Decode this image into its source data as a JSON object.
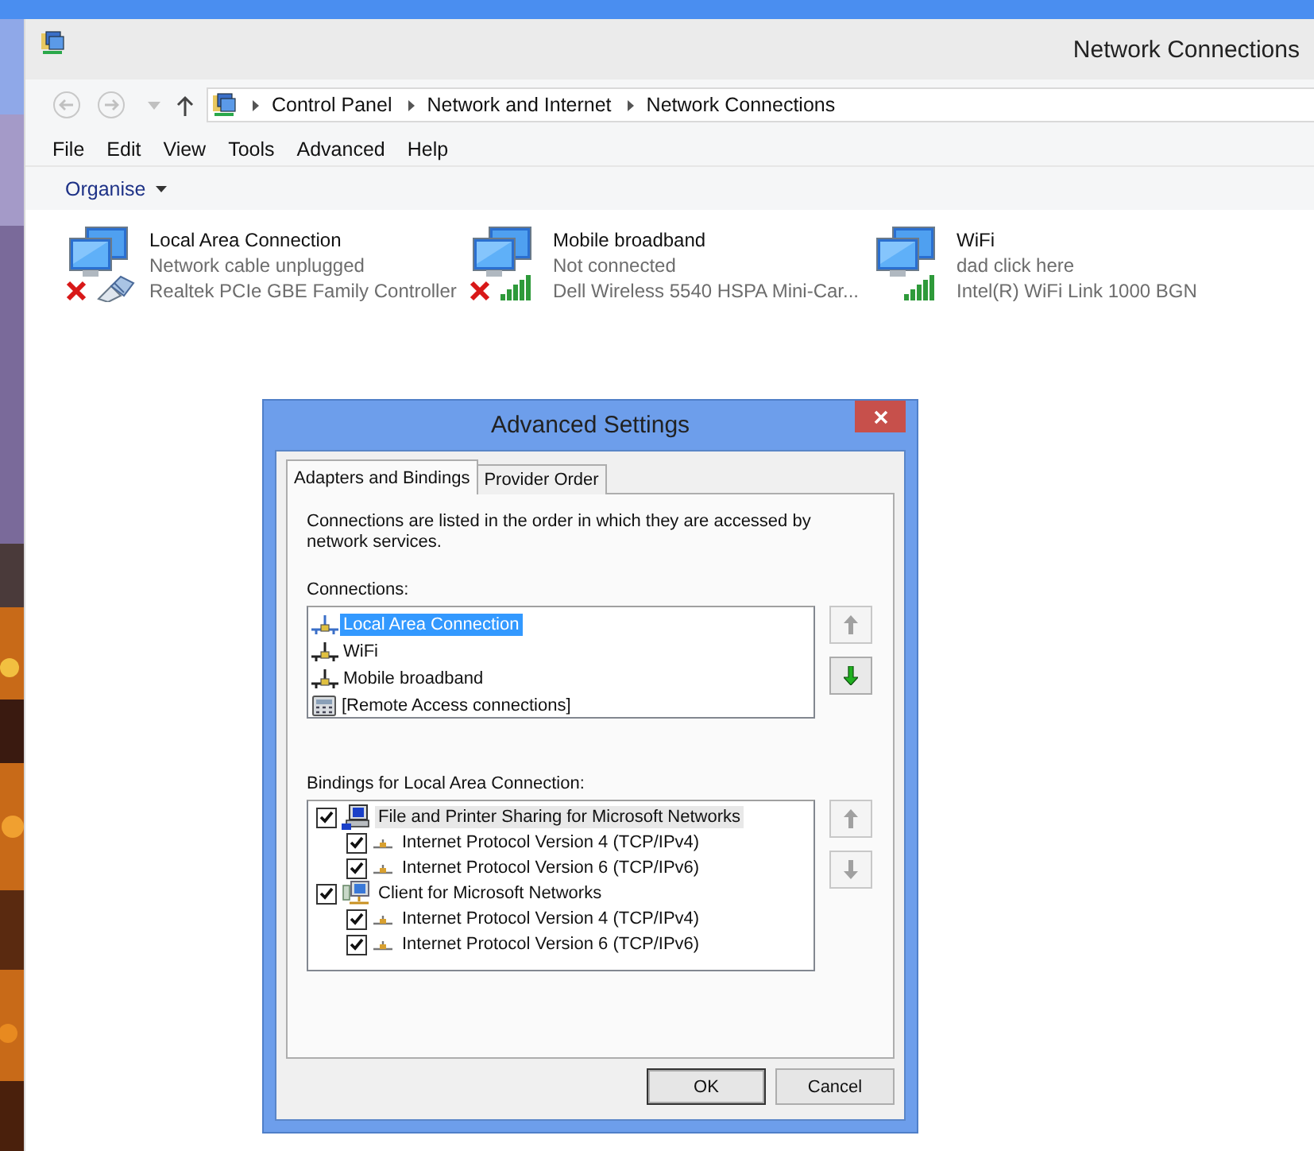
{
  "window": {
    "title": "Network Connections"
  },
  "address_bar": {
    "breadcrumbs": [
      "Control Panel",
      "Network and Internet",
      "Network Connections"
    ]
  },
  "menu": [
    "File",
    "Edit",
    "View",
    "Tools",
    "Advanced",
    "Help"
  ],
  "toolbar": {
    "organise": "Organise"
  },
  "connections": [
    {
      "name": "Local Area Connection",
      "status": "Network cable unplugged",
      "device": "Realtek PCIe GBE Family Controller",
      "kind": "ethernet",
      "disconnected": true
    },
    {
      "name": "Mobile broadband",
      "status": "Not connected",
      "device": "Dell Wireless 5540 HSPA Mini-Car...",
      "kind": "signal",
      "disconnected": true
    },
    {
      "name": "WiFi",
      "status": "dad click here",
      "device": "Intel(R) WiFi Link 1000 BGN",
      "kind": "signal",
      "disconnected": false
    }
  ],
  "dialog": {
    "title": "Advanced Settings",
    "tabs": [
      {
        "label": "Adapters and Bindings",
        "selected": true
      },
      {
        "label": "Provider Order",
        "selected": false
      }
    ],
    "description": "Connections are listed in the order in which they are accessed by network services.",
    "connections_label": "Connections:",
    "connections": [
      {
        "label": "Local Area Connection",
        "kind": "adapter",
        "selected": true
      },
      {
        "label": "WiFi",
        "kind": "adapter",
        "selected": false
      },
      {
        "label": "Mobile broadband",
        "kind": "adapter",
        "selected": false
      },
      {
        "label": "[Remote Access connections]",
        "kind": "remote",
        "selected": false
      }
    ],
    "connection_buttons": [
      {
        "kind": "up",
        "disabled": true
      },
      {
        "kind": "down",
        "disabled": false
      }
    ],
    "bindings_label": "Bindings for Local Area Connection:",
    "bindings": [
      {
        "label": "File and Printer Sharing for Microsoft Networks",
        "kind": "sharing",
        "checked": true,
        "selected": true,
        "children": [
          {
            "label": "Internet Protocol Version 4 (TCP/IPv4)",
            "checked": true,
            "selected": false
          },
          {
            "label": "Internet Protocol Version 6 (TCP/IPv6)",
            "checked": true,
            "selected": false
          }
        ]
      },
      {
        "label": "Client for Microsoft Networks",
        "kind": "client",
        "checked": true,
        "selected": false,
        "children": [
          {
            "label": "Internet Protocol Version 4 (TCP/IPv4)",
            "checked": true,
            "selected": false
          },
          {
            "label": "Internet Protocol Version 6 (TCP/IPv6)",
            "checked": true,
            "selected": false
          }
        ]
      }
    ],
    "binding_buttons": [
      {
        "kind": "up",
        "disabled": true
      },
      {
        "kind": "down",
        "disabled": true
      }
    ],
    "buttons": [
      "OK",
      "Cancel"
    ]
  }
}
